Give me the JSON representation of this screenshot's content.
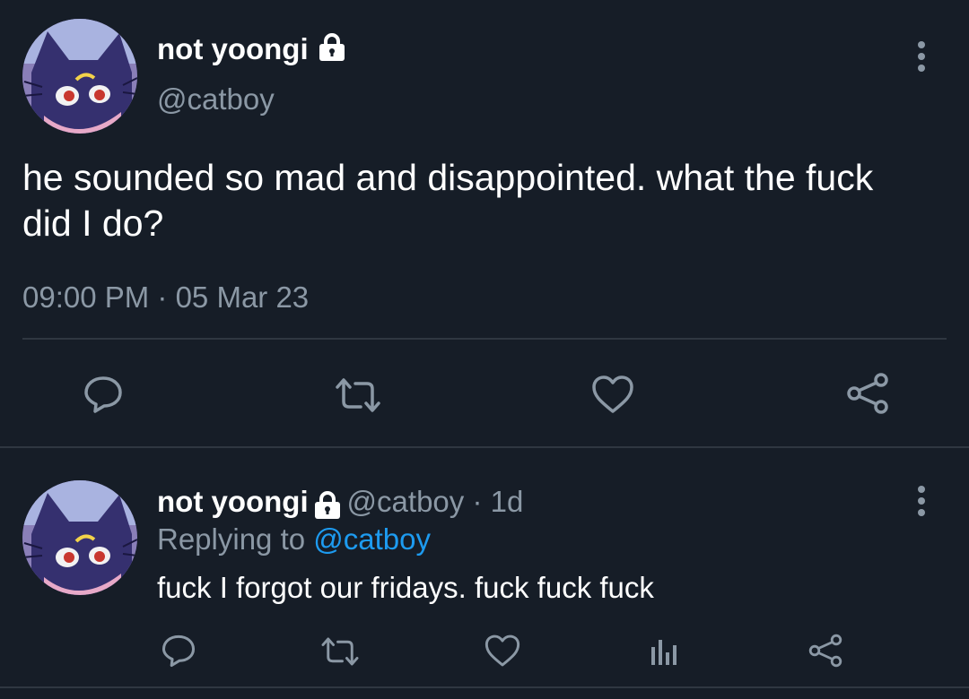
{
  "main_tweet": {
    "author_name": "not yoongi",
    "handle": "@catboy",
    "text_line1": "he sounded so mad and disappointed. what the fuck",
    "text_line2": "did I do?",
    "timestamp": "09:00 PM · 05 Mar 23",
    "avatar_icon": "cat-avatar",
    "lock_icon": "lock-icon",
    "actions": [
      "reply-icon",
      "retweet-icon",
      "like-icon",
      "share-icon"
    ]
  },
  "reply_tweet": {
    "author_name": "not yoongi",
    "handle_time": "@catboy · 1d",
    "replying_prefix": "Replying to",
    "replying_mention": "@catboy",
    "text": "fuck I forgot our fridays. fuck fuck fuck",
    "actions": [
      "reply-icon",
      "retweet-icon",
      "like-icon",
      "analytics-icon",
      "share-icon"
    ]
  },
  "colors": {
    "background": "#161d27",
    "text": "#ffffff",
    "secondary": "#8b98a5",
    "link": "#1d9bf0",
    "divider": "#2f3741",
    "avatar": "#3b3a7e"
  }
}
